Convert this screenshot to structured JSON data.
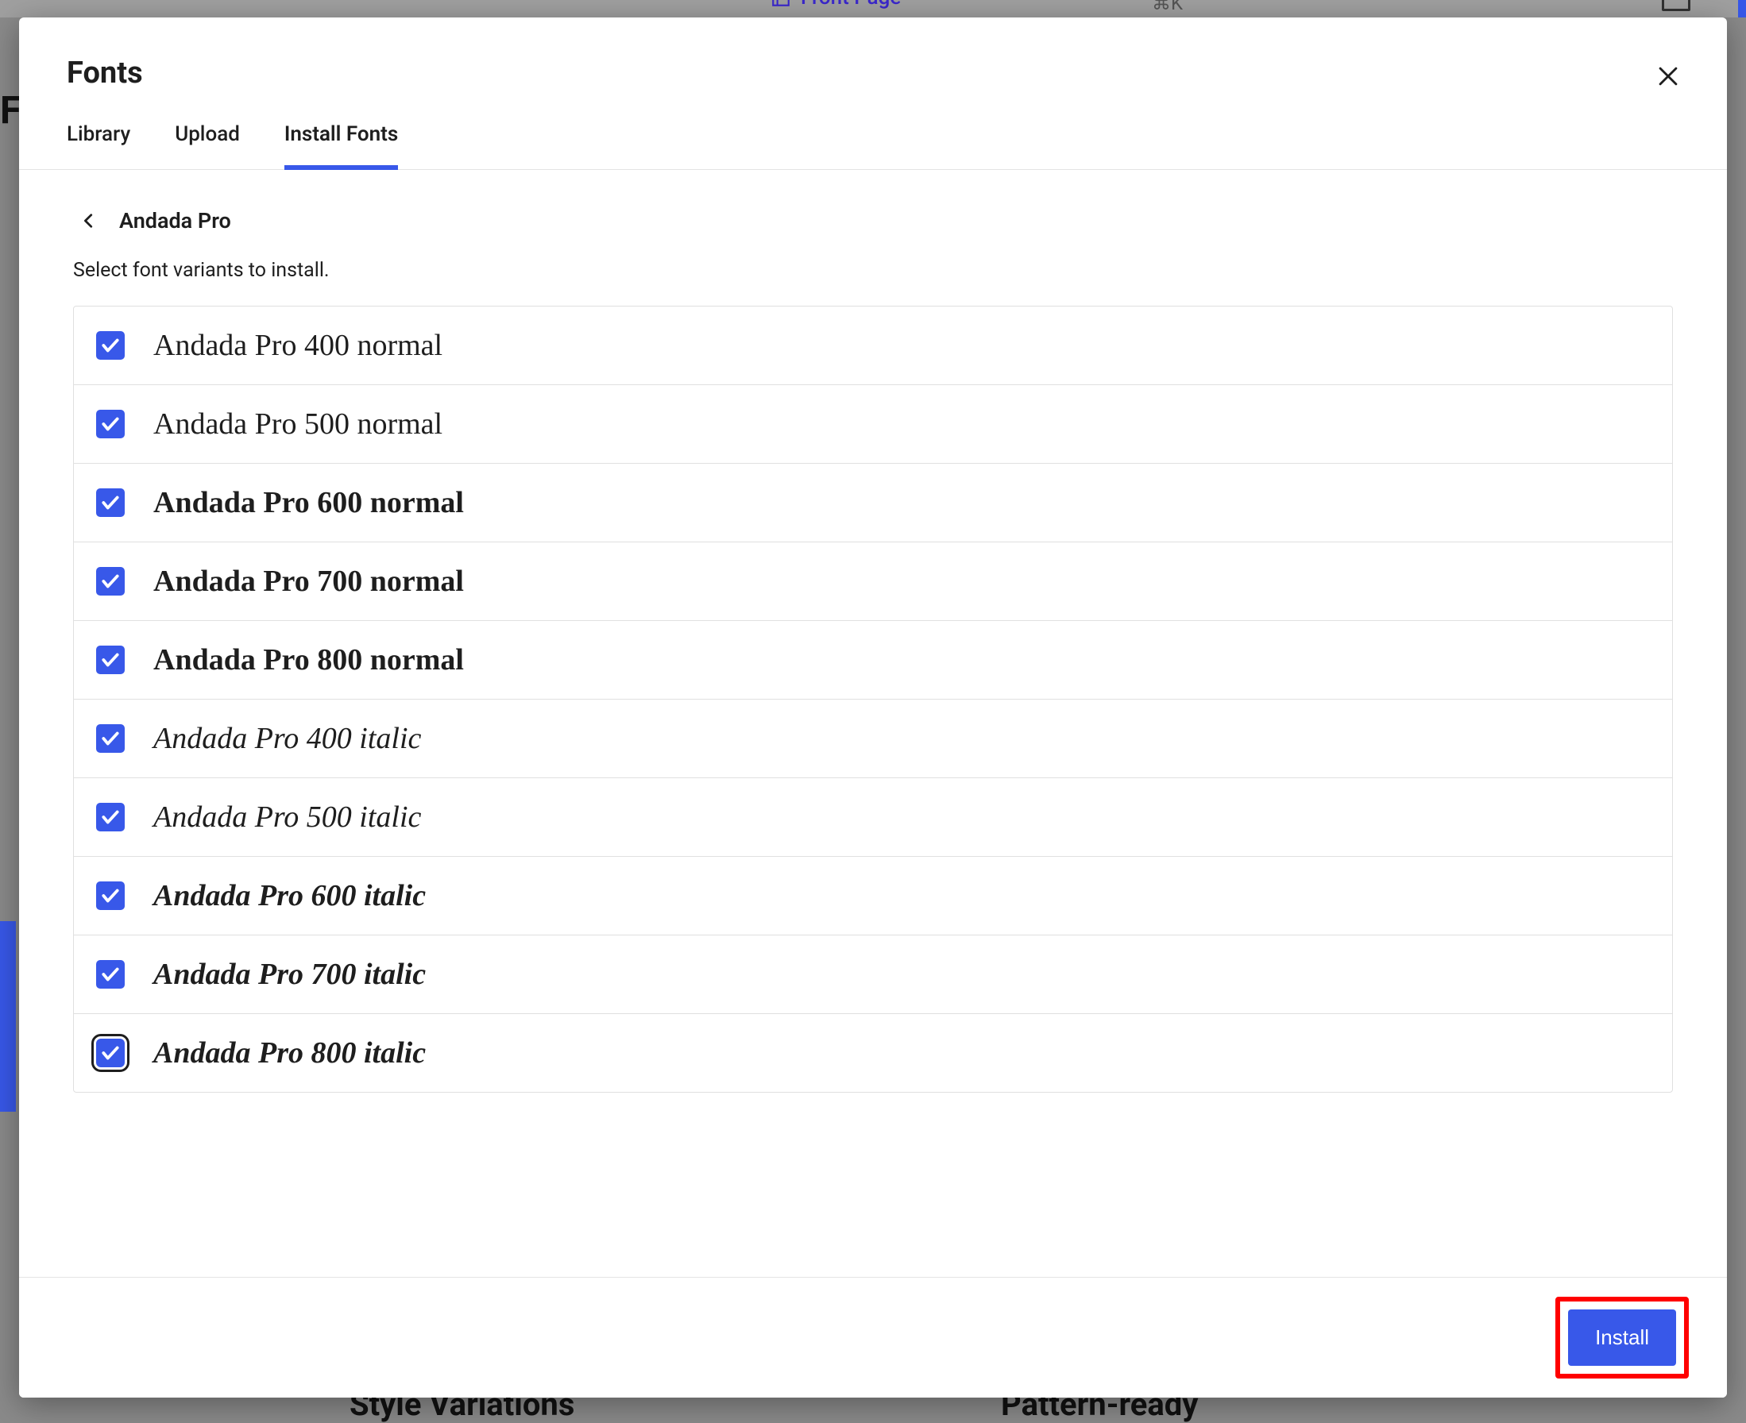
{
  "background": {
    "front_page_label": "Front Page",
    "shortcut": "⌘K",
    "left_letter": "F",
    "bottom_left": "Style Variations",
    "bottom_right": "Pattern-ready"
  },
  "modal": {
    "title": "Fonts",
    "tabs": [
      {
        "label": "Library",
        "active": false
      },
      {
        "label": "Upload",
        "active": false
      },
      {
        "label": "Install Fonts",
        "active": true
      }
    ],
    "breadcrumb": "Andada Pro",
    "instruction": "Select font variants to install.",
    "variants": [
      {
        "label": "Andada Pro 400 normal",
        "weight": 400,
        "italic": false,
        "checked": true,
        "focused": false
      },
      {
        "label": "Andada Pro 500 normal",
        "weight": 500,
        "italic": false,
        "checked": true,
        "focused": false
      },
      {
        "label": "Andada Pro 600 normal",
        "weight": 600,
        "italic": false,
        "checked": true,
        "focused": false
      },
      {
        "label": "Andada Pro 700 normal",
        "weight": 700,
        "italic": false,
        "checked": true,
        "focused": false
      },
      {
        "label": "Andada Pro 800 normal",
        "weight": 800,
        "italic": false,
        "checked": true,
        "focused": false
      },
      {
        "label": "Andada Pro 400 italic",
        "weight": 400,
        "italic": true,
        "checked": true,
        "focused": false
      },
      {
        "label": "Andada Pro 500 italic",
        "weight": 500,
        "italic": true,
        "checked": true,
        "focused": false
      },
      {
        "label": "Andada Pro 600 italic",
        "weight": 600,
        "italic": true,
        "checked": true,
        "focused": false
      },
      {
        "label": "Andada Pro 700 italic",
        "weight": 700,
        "italic": true,
        "checked": true,
        "focused": false
      },
      {
        "label": "Andada Pro 800 italic",
        "weight": 800,
        "italic": true,
        "checked": true,
        "focused": true
      }
    ],
    "install_label": "Install"
  }
}
